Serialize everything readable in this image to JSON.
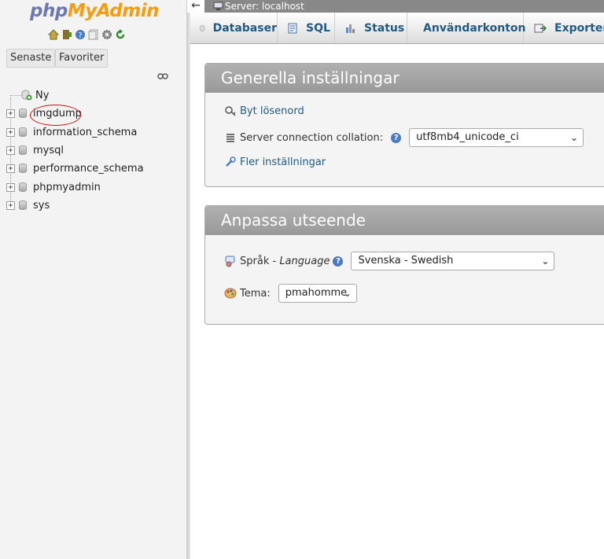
{
  "sidebar": {
    "logo": {
      "php": "php",
      "my": "My",
      "admin": "Admin"
    },
    "icons": [
      "home-icon",
      "exit-icon",
      "help-icon",
      "docs-icon",
      "settings-icon",
      "reload-icon"
    ],
    "buttons": {
      "recent": "Senaste",
      "favorites": "Favoriter"
    },
    "tree": {
      "new_label": "Ny",
      "databases": [
        "imgdump",
        "information_schema",
        "mysql",
        "performance_schema",
        "phpmyadmin",
        "sys"
      ]
    }
  },
  "topbar": {
    "back": "←",
    "server": "Server: localhost"
  },
  "menubar": {
    "tabs": [
      "Databaser",
      "SQL",
      "Status",
      "Användarkonton",
      "Exportera"
    ]
  },
  "general": {
    "title": "Generella inställningar",
    "change_password": "Byt lösenord",
    "collation_label": "Server connection collation:",
    "collation_value": "utf8mb4_unicode_ci",
    "more_settings": "Fler inställningar"
  },
  "appearance": {
    "title": "Anpassa utseende",
    "language_label": "Språk - ",
    "language_label_italic": "Language",
    "language_value": "Svenska - Swedish",
    "theme_label": "Tema:",
    "theme_value": "pmahomme"
  },
  "colors": {
    "link": "#235a81",
    "logo_php": "#6c78af",
    "logo_admin": "#f89c0e",
    "highlight": "#d01010"
  }
}
